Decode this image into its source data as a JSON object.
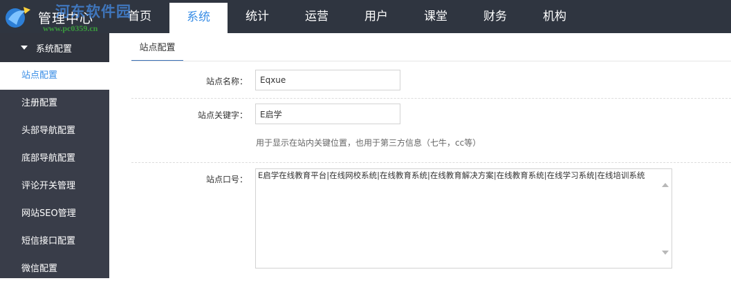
{
  "brand": {
    "title": "管理中心",
    "watermark_cn": "河东软件园",
    "watermark_url": "www.pc0359.cn"
  },
  "nav": {
    "tabs": [
      {
        "label": "首页"
      },
      {
        "label": "系统"
      },
      {
        "label": "统计"
      },
      {
        "label": "运营"
      },
      {
        "label": "用户"
      },
      {
        "label": "课堂"
      },
      {
        "label": "财务"
      },
      {
        "label": "机构"
      }
    ],
    "active_index": 1
  },
  "sidebar": {
    "group_label": "系统配置",
    "items": [
      {
        "label": "站点配置"
      },
      {
        "label": "注册配置"
      },
      {
        "label": "头部导航配置"
      },
      {
        "label": "底部导航配置"
      },
      {
        "label": "评论开关管理"
      },
      {
        "label": "网站SEO管理"
      },
      {
        "label": "短信接口配置"
      },
      {
        "label": "微信配置"
      }
    ],
    "active_index": 0
  },
  "main": {
    "sub_tab": "站点配置",
    "fields": {
      "site_name": {
        "label": "站点名称：",
        "value": "Eqxue"
      },
      "site_keyword": {
        "label": "站点关键字：",
        "value": "E启学"
      },
      "keyword_hint": "用于显示在站内关键位置，也用于第三方信息（七牛，cc等）",
      "site_slogan": {
        "label": "站点口号：",
        "value": "E启学在线教育平台|在线网校系统|在线教育系统|在线教育解决方案|在线教育系统|在线学习系统|在线培训系统"
      }
    }
  },
  "colors": {
    "topbar": "#2f3540",
    "sidebar": "#393d49",
    "sidebar_group": "#30343e",
    "accent": "#3a8ee6"
  }
}
